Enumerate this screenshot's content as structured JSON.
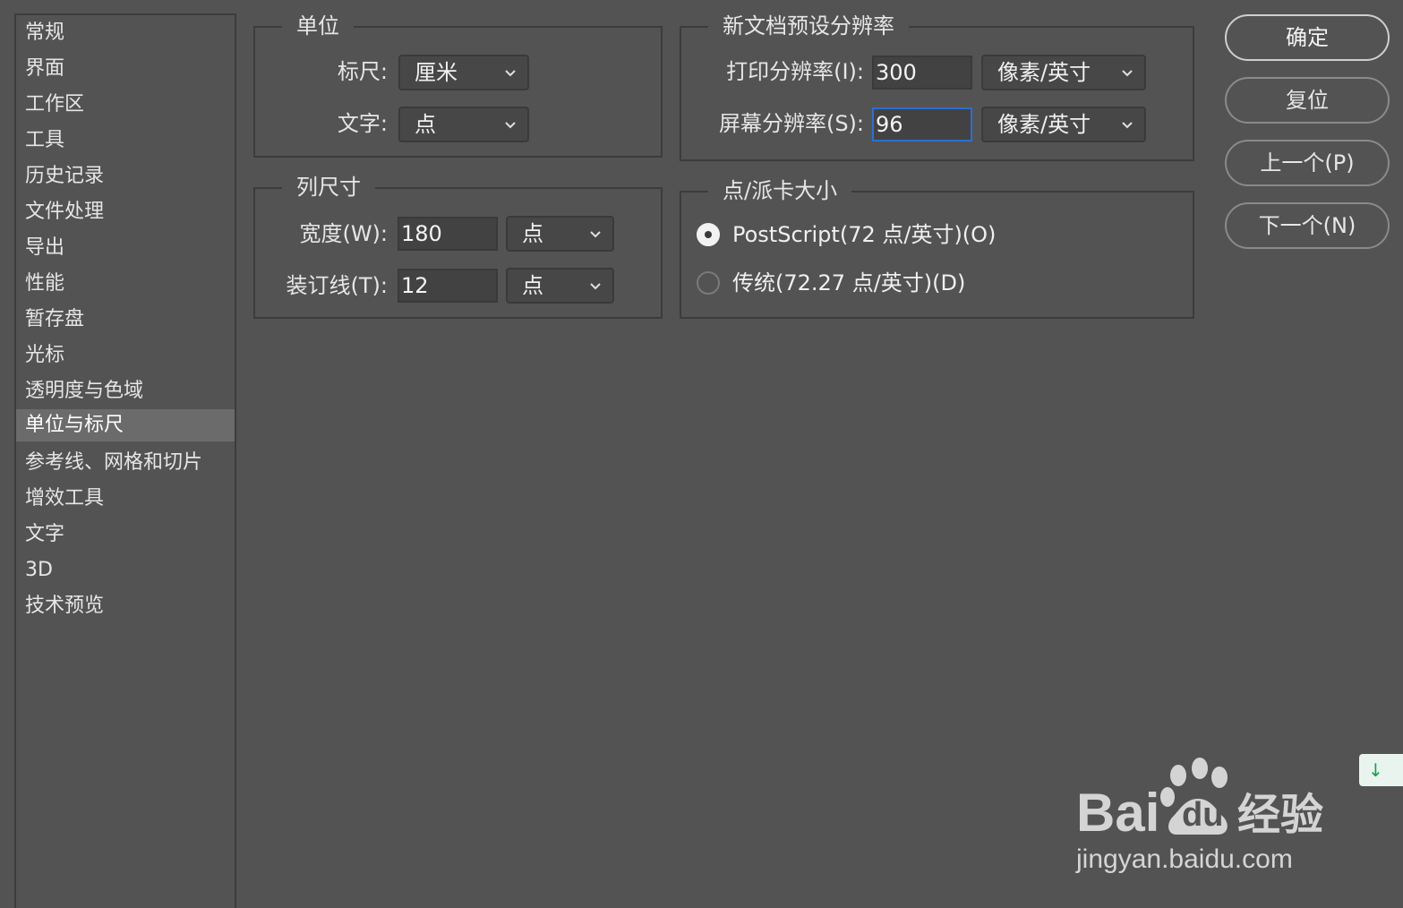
{
  "sidebar": {
    "items": [
      {
        "label": "常规"
      },
      {
        "label": "界面"
      },
      {
        "label": "工作区"
      },
      {
        "label": "工具"
      },
      {
        "label": "历史记录"
      },
      {
        "label": "文件处理"
      },
      {
        "label": "导出"
      },
      {
        "label": "性能"
      },
      {
        "label": "暂存盘"
      },
      {
        "label": "光标"
      },
      {
        "label": "透明度与色域"
      },
      {
        "label": "单位与标尺"
      },
      {
        "label": "参考线、网格和切片"
      },
      {
        "label": "增效工具"
      },
      {
        "label": "文字"
      },
      {
        "label": "3D"
      },
      {
        "label": "技术预览"
      }
    ],
    "selected": "单位与标尺"
  },
  "units": {
    "title": "单位",
    "ruler_label": "标尺:",
    "ruler_value": "厘米",
    "type_label": "文字:",
    "type_value": "点"
  },
  "column_size": {
    "title": "列尺寸",
    "width_label": "宽度(W):",
    "width_value": "180",
    "width_unit": "点",
    "gutter_label": "装订线(T):",
    "gutter_value": "12",
    "gutter_unit": "点"
  },
  "resolution": {
    "title": "新文档预设分辨率",
    "print_label": "打印分辨率(I):",
    "print_value": "300",
    "print_unit": "像素/英寸",
    "screen_label": "屏幕分辨率(S):",
    "screen_value": "96",
    "screen_unit": "像素/英寸"
  },
  "point_size": {
    "title": "点/派卡大小",
    "options": [
      {
        "label": "PostScript(72 点/英寸)(O)",
        "checked": true
      },
      {
        "label": "传统(72.27 点/英寸)(D)",
        "checked": false
      }
    ]
  },
  "buttons": {
    "ok": "确定",
    "reset": "复位",
    "prev": "上一个(P)",
    "next": "下一个(N)"
  },
  "watermark": {
    "brand": "Bai",
    "brand2": "du",
    "brand_cn": "经验",
    "url": "jingyan.baidu.com",
    "download_arrow": "↓"
  },
  "colors": {
    "background": "#535353",
    "border": "#3c3c3c",
    "focus": "#2c6fd1",
    "selected_item": "#6b6b6b"
  }
}
